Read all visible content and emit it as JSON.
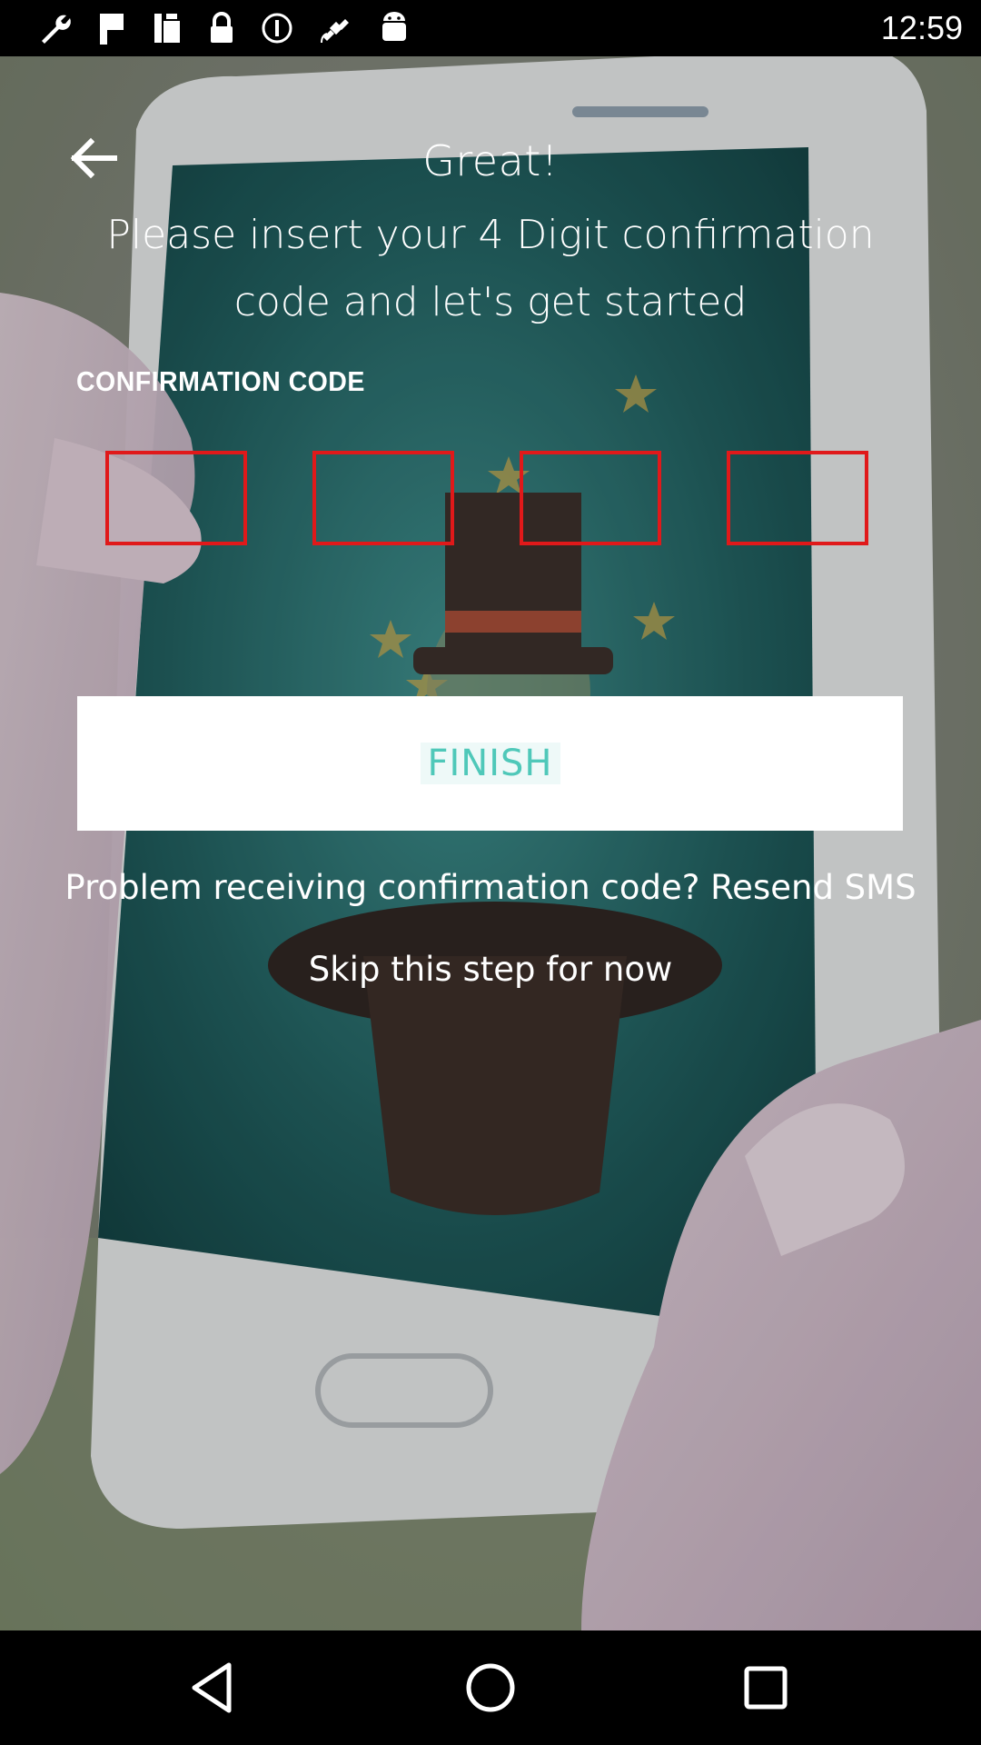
{
  "status_bar": {
    "time": "12:59",
    "icons": [
      "wrench-icon",
      "flag-icon",
      "fax-icon",
      "lock-icon",
      "circle-info-icon",
      "satellite-icon",
      "android-icon"
    ]
  },
  "header": {
    "back_icon": "arrow-left-icon",
    "title": "Great!",
    "subtitle": "Please insert your 4 Digit confirmation code and let's get started"
  },
  "form": {
    "code_label": "CONFIRMATION CODE",
    "digits": [
      "",
      "",
      "",
      ""
    ],
    "box_border_color": "#e0191a"
  },
  "actions": {
    "finish_label": "FINISH",
    "finish_color": "#4fc8b9",
    "resend_text": "Problem receiving confirmation code? Resend SMS",
    "skip_text": "Skip this step for now"
  },
  "nav_bar": {
    "icons": [
      "back-triangle-icon",
      "home-circle-icon",
      "recents-square-icon"
    ]
  }
}
